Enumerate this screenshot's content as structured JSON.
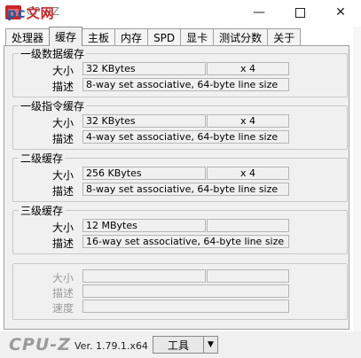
{
  "window": {
    "title": "CPU-Z",
    "watermark": "pc",
    "watermark_accent": "文网",
    "minimize": "—",
    "close": "✕"
  },
  "tabs": [
    "处理器",
    "缓存",
    "主板",
    "内存",
    "SPD",
    "显卡",
    "测试分数",
    "关于"
  ],
  "active_tab": "缓存",
  "l1d": {
    "title": "一级数据缓存",
    "size_label": "大小",
    "size": "32 KBytes",
    "ways": "x 4",
    "desc_label": "描述",
    "desc": "8-way set associative, 64-byte line size"
  },
  "l1i": {
    "title": "一级指令缓存",
    "size_label": "大小",
    "size": "32 KBytes",
    "ways": "x 4",
    "desc_label": "描述",
    "desc": "4-way set associative, 64-byte line size"
  },
  "l2": {
    "title": "二级缓存",
    "size_label": "大小",
    "size": "256 KBytes",
    "ways": "x 4",
    "desc_label": "描述",
    "desc": "8-way set associative, 64-byte line size"
  },
  "l3": {
    "title": "三级缓存",
    "size_label": "大小",
    "size": "12 MBytes",
    "ways": "",
    "desc_label": "描述",
    "desc": "16-way set associative, 64-byte line size"
  },
  "l4": {
    "size_label": "大小",
    "desc_label": "描述",
    "speed_label": "速度"
  },
  "footer": {
    "logo": "CPU-Z",
    "version": "Ver. 1.79.1.x64",
    "tools": "工具",
    "tools_arrow": "▼"
  }
}
